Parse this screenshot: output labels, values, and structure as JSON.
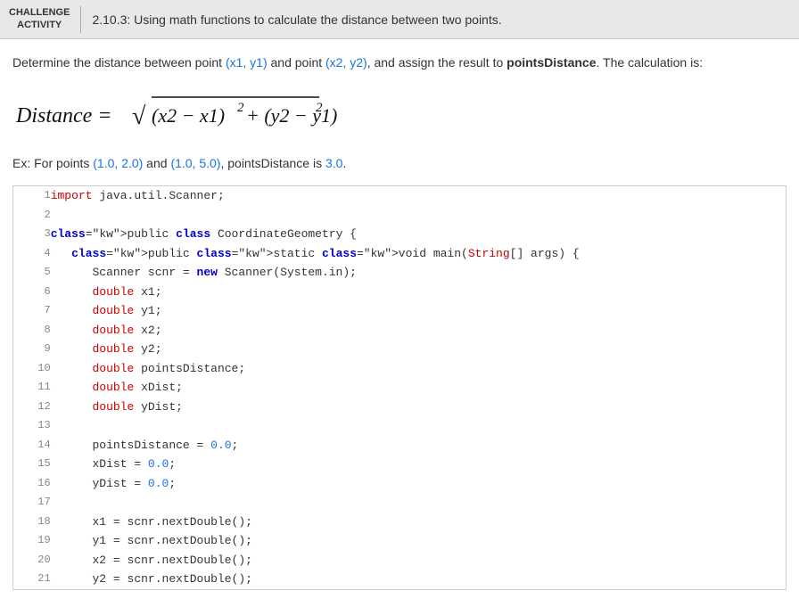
{
  "header": {
    "challenge_line1": "CHALLENGE",
    "challenge_line2": "ACTIVITY",
    "title": "2.10.3: Using math functions to calculate the distance between two points."
  },
  "content": {
    "description": "Determine the distance between point (x1, y1) and point (x2, y2), and assign the result to pointsDistance. The calculation is:",
    "example": "Ex: For points (1.0, 2.0) and (1.0, 5.0), pointsDistance is 3.0."
  },
  "code": {
    "lines": [
      {
        "num": 1,
        "text": "import java.util.Scanner;"
      },
      {
        "num": 2,
        "text": ""
      },
      {
        "num": 3,
        "text": "public class CoordinateGeometry {"
      },
      {
        "num": 4,
        "text": "   public static void main(String[] args) {"
      },
      {
        "num": 5,
        "text": "      Scanner scnr = new Scanner(System.in);"
      },
      {
        "num": 6,
        "text": "      double x1;"
      },
      {
        "num": 7,
        "text": "      double y1;"
      },
      {
        "num": 8,
        "text": "      double x2;"
      },
      {
        "num": 9,
        "text": "      double y2;"
      },
      {
        "num": 10,
        "text": "      double pointsDistance;"
      },
      {
        "num": 11,
        "text": "      double xDist;"
      },
      {
        "num": 12,
        "text": "      double yDist;"
      },
      {
        "num": 13,
        "text": ""
      },
      {
        "num": 14,
        "text": "      pointsDistance = 0.0;"
      },
      {
        "num": 15,
        "text": "      xDist = 0.0;"
      },
      {
        "num": 16,
        "text": "      yDist = 0.0;"
      },
      {
        "num": 17,
        "text": ""
      },
      {
        "num": 18,
        "text": "      x1 = scnr.nextDouble();"
      },
      {
        "num": 19,
        "text": "      y1 = scnr.nextDouble();"
      },
      {
        "num": 20,
        "text": "      x2 = scnr.nextDouble();"
      },
      {
        "num": 21,
        "text": "      y2 = scnr.nextDouble();"
      }
    ]
  }
}
